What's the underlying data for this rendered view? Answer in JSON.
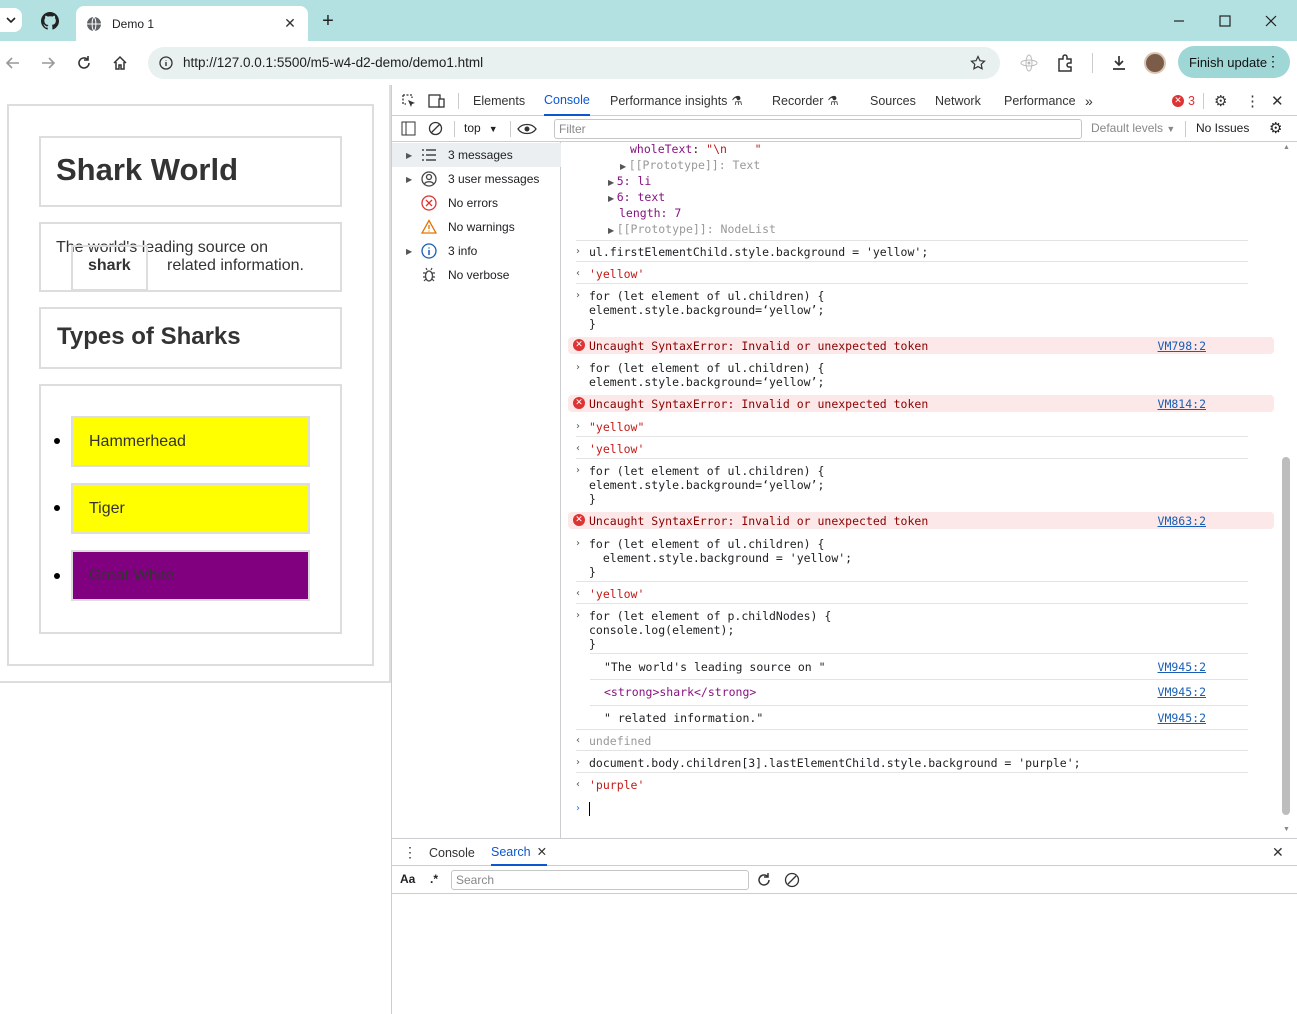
{
  "browser": {
    "tab_title": "Demo 1",
    "url": "http://127.0.0.1:5500/m5-w4-d2-demo/demo1.html",
    "finish_update": "Finish update"
  },
  "page": {
    "heading": "Shark World",
    "para_before": "The world's leading source on",
    "para_strong": "shark",
    "para_after": "related information.",
    "subheading": "Types of Sharks",
    "sharks": [
      {
        "name": "Hammerhead",
        "bg": "#ffff00"
      },
      {
        "name": "Tiger",
        "bg": "#ffff00"
      },
      {
        "name": "Great White",
        "bg": "#800080"
      }
    ]
  },
  "devtools": {
    "tabs": [
      "Elements",
      "Console",
      "Performance insights",
      "Recorder",
      "Sources",
      "Network",
      "Performance"
    ],
    "error_count": "3",
    "context": "top",
    "filter_placeholder": "Filter",
    "levels": "Default levels",
    "issues": "No Issues",
    "sidebar": [
      {
        "label": "3 messages",
        "icon": "list-icon"
      },
      {
        "label": "3 user messages",
        "icon": "user-icon"
      },
      {
        "label": "No errors",
        "icon": "error-icon"
      },
      {
        "label": "No warnings",
        "icon": "warning-icon"
      },
      {
        "label": "3 info",
        "icon": "info-icon"
      },
      {
        "label": "No verbose",
        "icon": "bug-icon"
      }
    ],
    "console": {
      "wholetext_line": "wholeText: \"\\n    \"",
      "proto_text": "[[Prototype]]: Text",
      "item5": "5: li",
      "item6": "6: text",
      "length": "length: 7",
      "proto_nodelist": "[[Prototype]]: NodeList",
      "cmd1": "ul.firstElementChild.style.background = 'yellow';",
      "res1": "'yellow'",
      "for_head": "for (let element of ul.children) {",
      "for_body_bad": "element.style.background=‘yellow’;",
      "close": "}",
      "error": "Uncaught SyntaxError: Invalid or unexpected token",
      "err_link1": "VM798:2",
      "err_link2": "VM814:2",
      "cmd_yellow": "\"yellow\"",
      "res_yellow": "'yellow'",
      "err_link3": "VM863:2",
      "for_body_good": "  element.style.background = 'yellow';",
      "res_good": "'yellow'",
      "for_p_head": "for (let element of p.childNodes) {",
      "for_p_body": "console.log(element);",
      "log1": "\"The world's leading source on \"",
      "log2": "<strong>shark</strong>",
      "log3": "\" related information.\"",
      "log_link": "VM945:2",
      "undefined": "undefined",
      "cmd_purple": "document.body.children[3].lastElementChild.style.background = 'purple';",
      "res_purple": "'purple'"
    },
    "drawer": {
      "tabs": [
        "Console",
        "Search"
      ],
      "search_placeholder": "Search",
      "case_toggle": "Aa",
      "regex_toggle": ".*"
    }
  }
}
